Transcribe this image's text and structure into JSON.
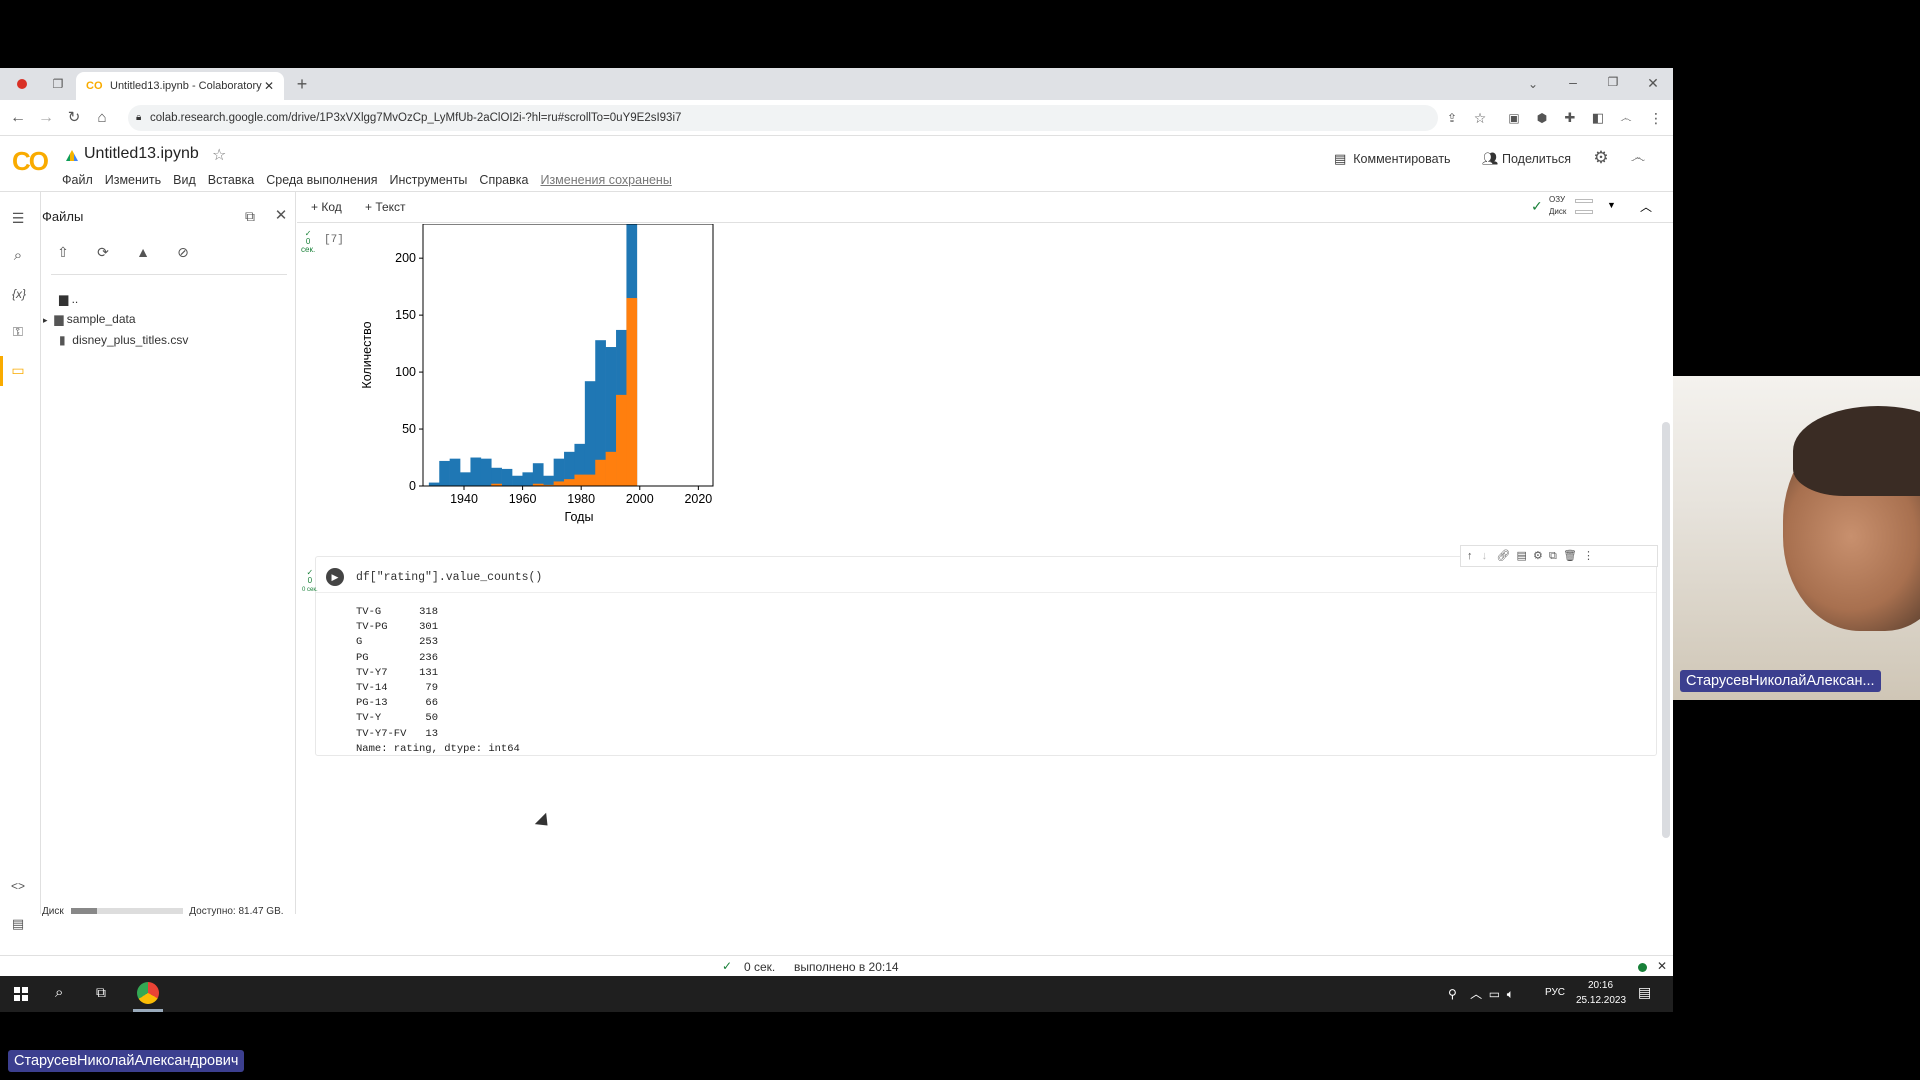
{
  "browser": {
    "tab_title": "Untitled13.ipynb - Colaboratory",
    "url": "colab.research.google.com/drive/1P3xVXlgg7MvOzCp_LyMfUb-2aClOI2i-?hl=ru#scrollTo=0uY9E2sI93i7"
  },
  "colab": {
    "logo": "CO",
    "notebook_title": "Untitled13.ipynb",
    "menu": [
      "Файл",
      "Изменить",
      "Вид",
      "Вставка",
      "Среда выполнения",
      "Инструменты",
      "Справка"
    ],
    "saved_status": "Изменения сохранены",
    "comment_label": "Комментировать",
    "share_label": "Поделиться",
    "add_code": "+ Код",
    "add_text": "+ Текст",
    "ram_label": "ОЗУ",
    "disk_label": "Диск"
  },
  "files": {
    "title": "Файлы",
    "parent": "..",
    "items": [
      "sample_data",
      "disney_plus_titles.csv"
    ],
    "disk_label": "Диск",
    "available": "Доступно: 81.47 GB."
  },
  "cells": {
    "chart_cell_exec": "[7]",
    "code": "df[\"rating\"].value_counts()",
    "output_rows": [
      [
        "TV-G",
        "318"
      ],
      [
        "TV-PG",
        "301"
      ],
      [
        "G",
        "253"
      ],
      [
        "PG",
        "236"
      ],
      [
        "TV-Y7",
        "131"
      ],
      [
        "TV-14",
        "79"
      ],
      [
        "PG-13",
        "66"
      ],
      [
        "TV-Y",
        "50"
      ],
      [
        "TV-Y7-FV",
        "13"
      ]
    ],
    "output_footer": "Name: rating, dtype: int64",
    "exec_time_label": "0 сек."
  },
  "chart_data": {
    "type": "bar",
    "xlabel": "Годы",
    "ylabel": "Количество",
    "xticks": [
      "1940",
      "1960",
      "1980",
      "2000",
      "2020"
    ],
    "yticks": [
      "0",
      "50",
      "100",
      "150",
      "200"
    ],
    "xlim": [
      1926,
      2025
    ],
    "ylim": [
      0,
      230
    ],
    "bin_width": 3.55,
    "bin_start": 1928,
    "series": [
      {
        "color": "#1f77b4",
        "values": [
          3,
          22,
          24,
          12,
          25,
          24,
          16,
          15,
          9,
          12,
          20,
          9,
          24,
          30,
          37,
          92,
          128,
          122,
          137,
          230
        ]
      },
      {
        "color": "#ff7f0e",
        "values": [
          0,
          0,
          0,
          0,
          0,
          0,
          2,
          0,
          0,
          0,
          2,
          1,
          4,
          6,
          10,
          10,
          23,
          30,
          80,
          165
        ]
      }
    ]
  },
  "status_bar": {
    "exec_time": "0 сек.",
    "executed_at": "выполнено в 20:14"
  },
  "taskbar": {
    "lang": "РУС",
    "time": "20:16",
    "date": "25.12.2023"
  },
  "video": {
    "participant_name": "СтарусевНиколайАлексан...",
    "full_name": "СтарусевНиколайАлександрович"
  }
}
